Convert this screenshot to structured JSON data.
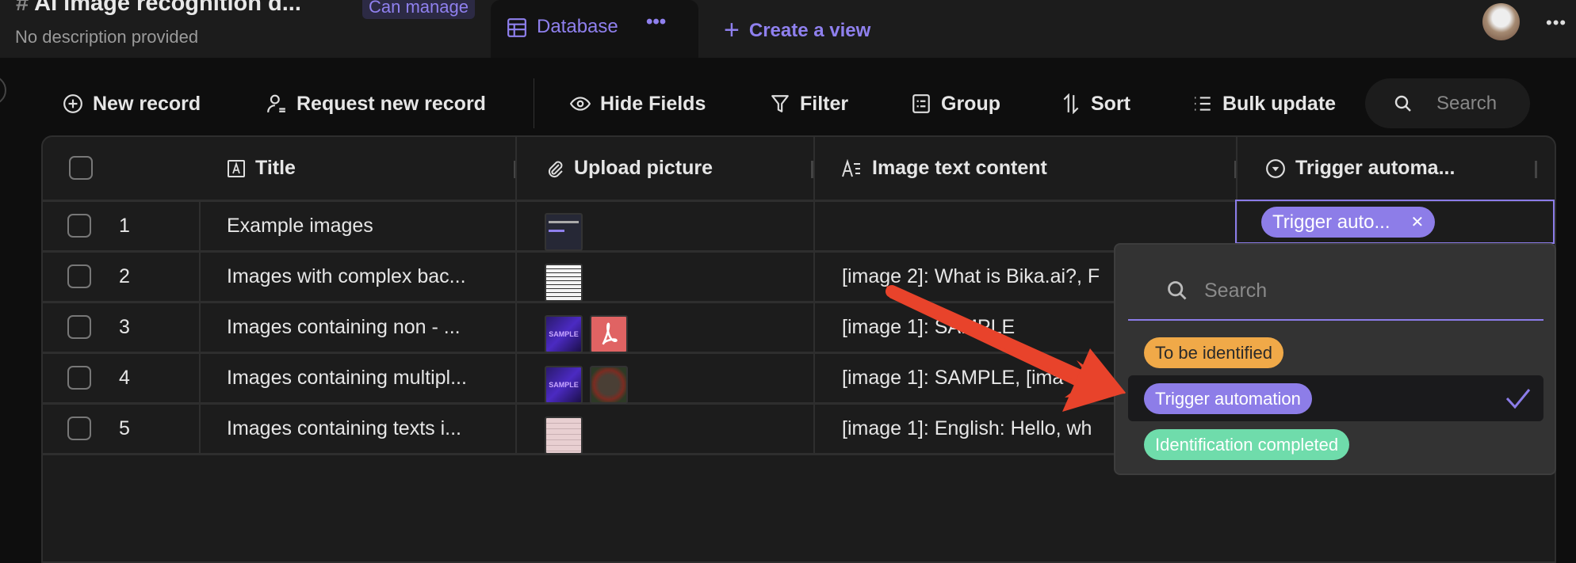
{
  "header": {
    "title": "AI image recognition d...",
    "permission_badge": "Can manage",
    "description": "No description provided",
    "tab_label": "Database",
    "create_view_label": "Create a view"
  },
  "toolbar": {
    "new_record": "New record",
    "request_new_record": "Request new record",
    "hide_fields": "Hide Fields",
    "filter": "Filter",
    "group": "Group",
    "sort": "Sort",
    "bulk_update": "Bulk update",
    "search_placeholder": "Search"
  },
  "table": {
    "columns": [
      {
        "label": "Title",
        "icon": "text-field-icon"
      },
      {
        "label": "Upload picture",
        "icon": "attachment-icon"
      },
      {
        "label": "Image text content",
        "icon": "long-text-icon"
      },
      {
        "label": "Trigger automa...",
        "icon": "single-select-icon"
      }
    ],
    "rows": [
      {
        "num": "1",
        "title": "Example images",
        "text": "",
        "status": "Trigger auto..."
      },
      {
        "num": "2",
        "title": "Images with complex bac...",
        "text": "[image 2]: What is Bika.ai?, F"
      },
      {
        "num": "3",
        "title": "Images containing non - ...",
        "text": "[image 1]: SAMPLE"
      },
      {
        "num": "4",
        "title": "Images containing multipl...",
        "text": "[image 1]: SAMPLE, [ima"
      },
      {
        "num": "5",
        "title": "Images containing texts i...",
        "text": "[image 1]: English: Hello, wh"
      }
    ]
  },
  "dropdown": {
    "search_placeholder": "Search",
    "options": [
      {
        "label": "To be identified",
        "color": "#f0a948",
        "selected": false
      },
      {
        "label": "Trigger automation",
        "color": "#8d7de8",
        "selected": true
      },
      {
        "label": "Identification completed",
        "color": "#6fdcab",
        "selected": false
      }
    ]
  },
  "colors": {
    "accent": "#8f80ee",
    "annotation_arrow": "#e8432b"
  }
}
